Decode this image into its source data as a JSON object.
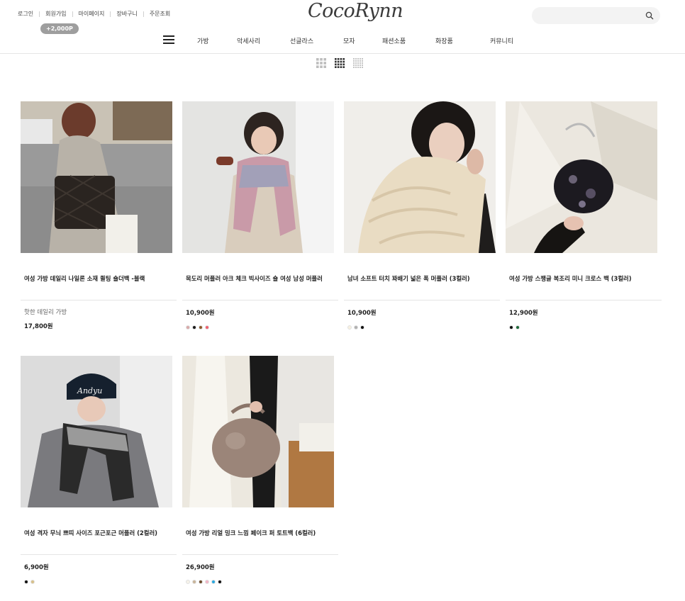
{
  "header": {
    "util_links": [
      "로그인",
      "회원가입",
      "마이페이지",
      "장바구니",
      "주문조회"
    ],
    "point_badge": "+2,000P",
    "logo": "CocoRynn",
    "search": {
      "placeholder": "",
      "value": ""
    }
  },
  "nav": {
    "menu": [
      "가방",
      "악세사리",
      "선글라스",
      "모자",
      "패션소품",
      "화장품",
      "커뮤니티"
    ]
  },
  "view_modes": [
    "grid-small-icon",
    "grid-medium-icon",
    "grid-large-icon"
  ],
  "products": [
    {
      "name": "여성 가방 데일리 나일론 소재 퀼팅 숄더백 -블랙",
      "summary": "핫한 데일리 가방",
      "price": "17,800원",
      "colors": []
    },
    {
      "name": "목도리 머플러 아크 체크 빅사이즈 숄 여성 남성 머플러",
      "summary": "",
      "price": "10,900원",
      "colors": [
        "#d9a9a9",
        "#1a1a1a",
        "#8b5a2b",
        "#f06070"
      ]
    },
    {
      "name": "남녀 소프트 터치 꽈배기 넓은 폭 머플러 (3컬러)",
      "summary": "",
      "price": "10,900원",
      "colors": [
        "#f7f1e1",
        "#b0b0b0",
        "#111111"
      ]
    },
    {
      "name": "여성 가방 스팽글 복조리 미니 크로스 백 (3컬러)",
      "summary": "",
      "price": "12,900원",
      "colors": [
        "#111111",
        "#1d6a3a"
      ]
    },
    {
      "name": "여성 격자 무늬 쁘띠 사이즈 포근포근 머플러 (2컬러)",
      "summary": "",
      "price": "6,900원",
      "colors": [
        "#111111",
        "#d8c08a"
      ]
    },
    {
      "name": "여성 가방 리얼 밍크 느낌 페이크 퍼 토트백 (6컬러)",
      "summary": "",
      "price": "26,900원",
      "colors": [
        "#f6f3ea",
        "#c9b59a",
        "#6b4a2a",
        "#f2b6c6",
        "#29a8e0",
        "#111111"
      ]
    }
  ]
}
